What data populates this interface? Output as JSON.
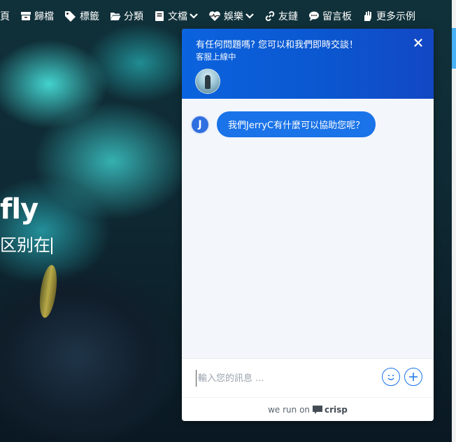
{
  "nav": {
    "items": [
      {
        "label": "首頁",
        "icon": "home-icon"
      },
      {
        "label": "歸檔",
        "icon": "archive-icon"
      },
      {
        "label": "標籤",
        "icon": "tags-icon"
      },
      {
        "label": "分類",
        "icon": "folder-open-icon"
      },
      {
        "label": "文檔",
        "icon": "book-icon",
        "dropdown": true
      },
      {
        "label": "娛樂",
        "icon": "heartbeat-icon",
        "dropdown": true
      },
      {
        "label": "友鏈",
        "icon": "link-icon"
      },
      {
        "label": "留言板",
        "icon": "comment-icon"
      },
      {
        "label": "更多示例",
        "icon": "hand-icon"
      }
    ]
  },
  "hero": {
    "title": "fly",
    "subtitle": "区别在"
  },
  "chat": {
    "header_title": "有任何問題嗎? 您可以和我們即時交談！",
    "header_status": "客服上線中",
    "message": {
      "avatar_letter": "J",
      "text": "我們JerryC有什麼可以協助您呢？"
    },
    "compose_placeholder": "輸入您的訊息 ...",
    "footer_prefix": "we run on",
    "footer_brand": "crisp"
  },
  "colors": {
    "chat_header": "#0b63de",
    "bubble": "#1a73e8",
    "chat_bg": "#f3f6fb"
  }
}
